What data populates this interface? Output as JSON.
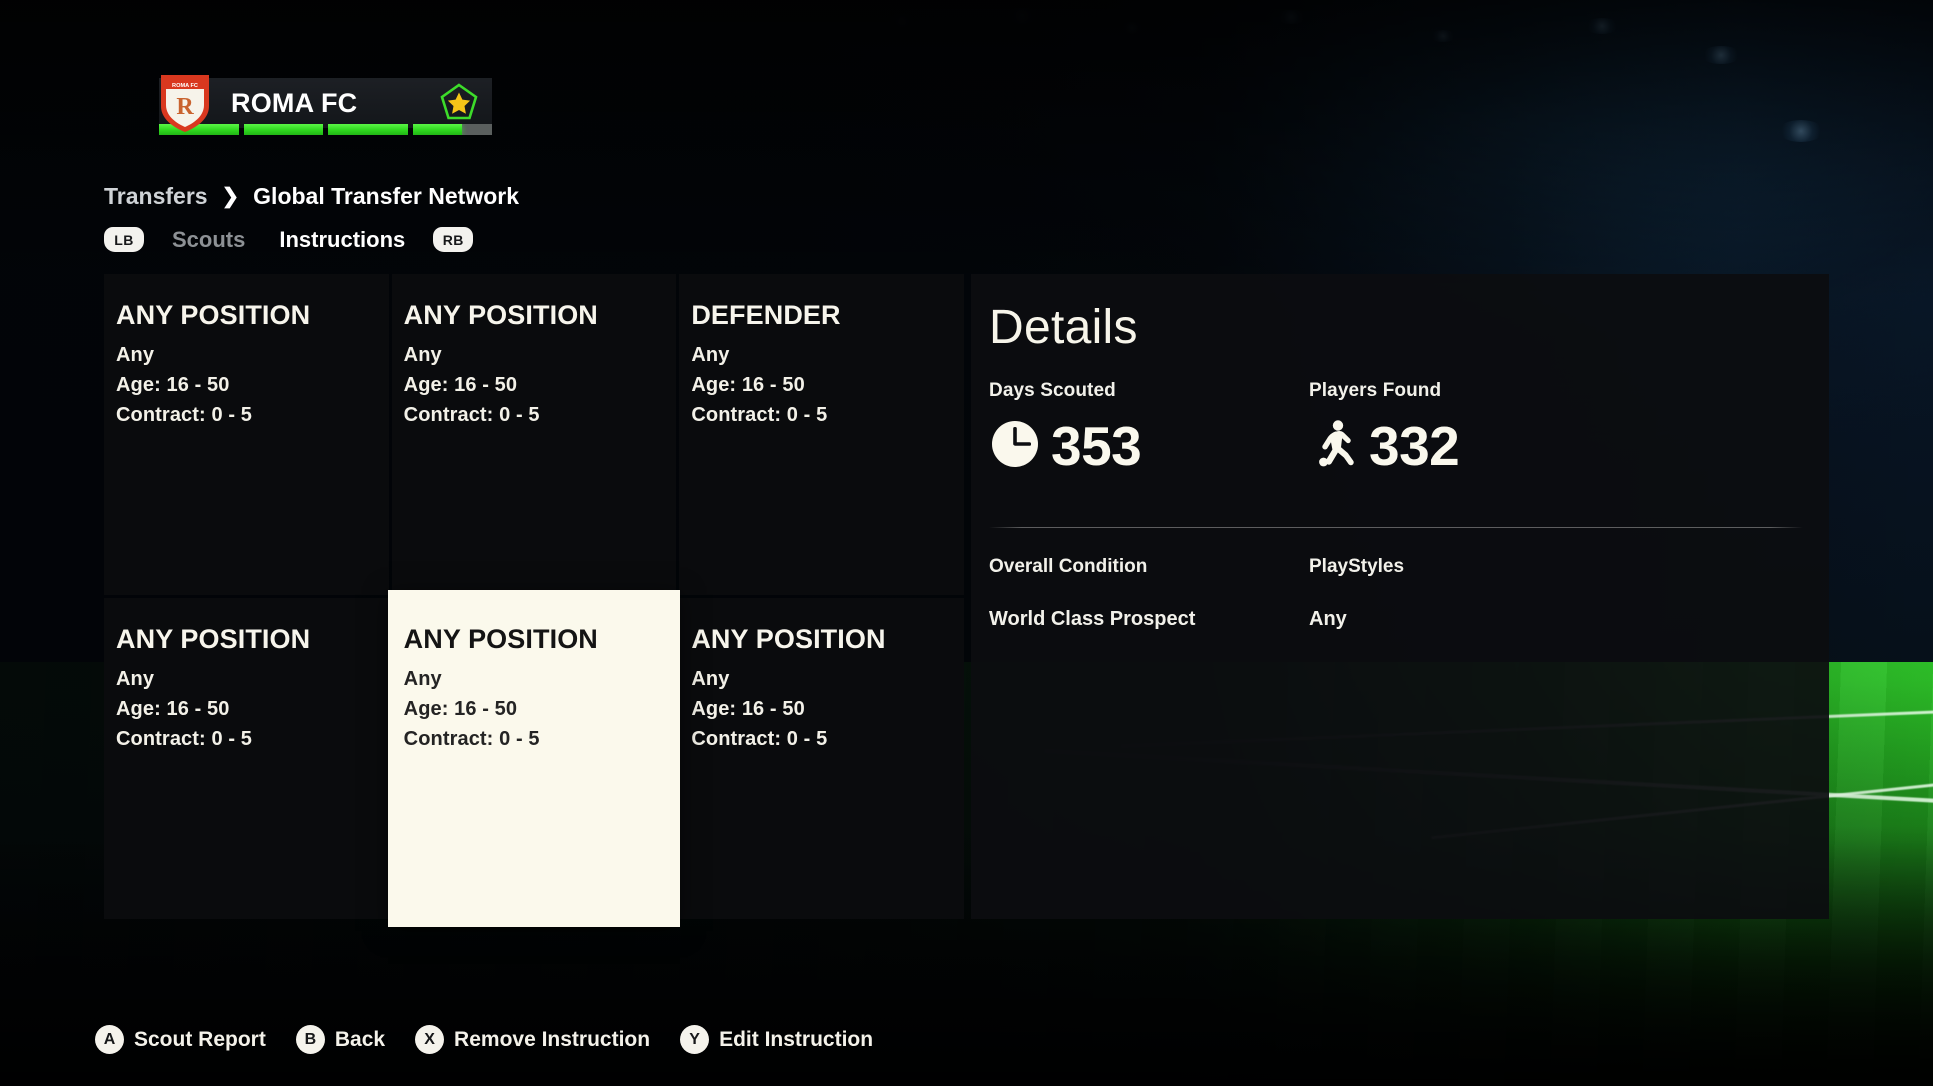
{
  "club": {
    "name": "ROMA FC",
    "crest_icon": "club-crest-shield",
    "crest_text": "ROMA FC",
    "crest_monogram": "R",
    "star_icon": "star-badge-icon",
    "progress_segments": [
      100,
      100,
      100,
      62
    ]
  },
  "breadcrumb": {
    "root": "Transfers",
    "separator": "›",
    "current": "Global Transfer Network"
  },
  "tabs": {
    "left_bumper": "LB",
    "right_bumper": "RB",
    "items": [
      {
        "label": "Scouts",
        "active": false
      },
      {
        "label": "Instructions",
        "active": true
      }
    ]
  },
  "instructions": [
    {
      "position": "ANY POSITION",
      "nationality": "Any",
      "age": "Age: 16 - 50",
      "contract": "Contract: 0 - 5",
      "selected": false
    },
    {
      "position": "ANY POSITION",
      "nationality": "Any",
      "age": "Age: 16 - 50",
      "contract": "Contract: 0 - 5",
      "selected": false
    },
    {
      "position": "DEFENDER",
      "nationality": "Any",
      "age": "Age: 16 - 50",
      "contract": "Contract: 0 - 5",
      "selected": false
    },
    {
      "position": "ANY POSITION",
      "nationality": "Any",
      "age": "Age: 16 - 50",
      "contract": "Contract: 0 - 5",
      "selected": false
    },
    {
      "position": "ANY POSITION",
      "nationality": "Any",
      "age": "Age: 16 - 50",
      "contract": "Contract: 0 - 5",
      "selected": true
    },
    {
      "position": "ANY POSITION",
      "nationality": "Any",
      "age": "Age: 16 - 50",
      "contract": "Contract: 0 - 5",
      "selected": false
    }
  ],
  "details": {
    "title": "Details",
    "days_scouted_label": "Days Scouted",
    "days_scouted_value": "353",
    "days_scouted_icon": "clock-icon",
    "players_found_label": "Players Found",
    "players_found_value": "332",
    "players_found_icon": "player-with-ball-icon",
    "overall_condition_label": "Overall Condition",
    "overall_condition_value": "World Class Prospect",
    "playstyles_label": "PlayStyles",
    "playstyles_value": "Any"
  },
  "actions": [
    {
      "glyph": "A",
      "label": "Scout Report"
    },
    {
      "glyph": "B",
      "label": "Back"
    },
    {
      "glyph": "X",
      "label": "Remove Instruction"
    },
    {
      "glyph": "Y",
      "label": "Edit Instruction"
    }
  ],
  "colors": {
    "accent_green": "#2fd81f",
    "selected_card_bg": "#fbf9ec",
    "panel_bg": "#0a0b0d",
    "text_primary": "#f7f5ec",
    "text_muted": "#8d9195",
    "crest_red": "#d9381f",
    "star_gold": "#f5c518"
  }
}
